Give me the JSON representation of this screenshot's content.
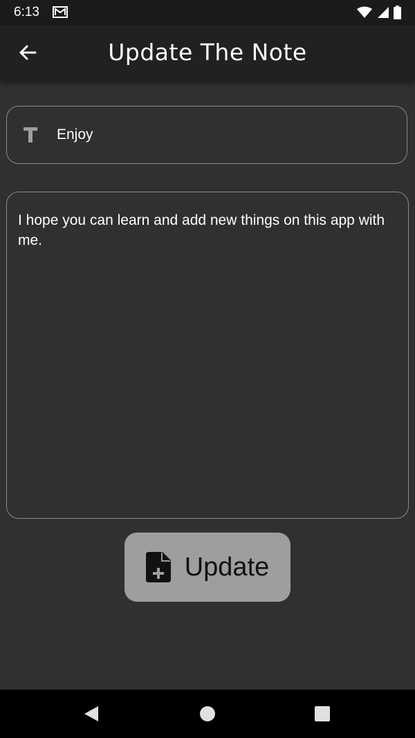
{
  "status_bar": {
    "time": "6:13",
    "icons": [
      "gmail-icon",
      "wifi-icon",
      "signal-icon",
      "battery-icon"
    ]
  },
  "app_bar": {
    "title": "Update The Note",
    "back_icon": "arrow-left-icon"
  },
  "form": {
    "title_value": "Enjoy",
    "title_icon": "title-t-icon",
    "content_value": "I hope you can learn and add new things on this app with me."
  },
  "update_button": {
    "label": "Update",
    "icon": "note-add-icon"
  },
  "nav_bar": {
    "icons": [
      "back-triangle-icon",
      "home-circle-icon",
      "recents-square-icon"
    ]
  },
  "colors": {
    "background": "#303030",
    "app_bar": "#212121",
    "status_bar": "#1b1b1b",
    "field_border": "#8a8a8a",
    "button": "#9e9e9e",
    "nav_bar": "#000000",
    "text": "#ffffff"
  }
}
